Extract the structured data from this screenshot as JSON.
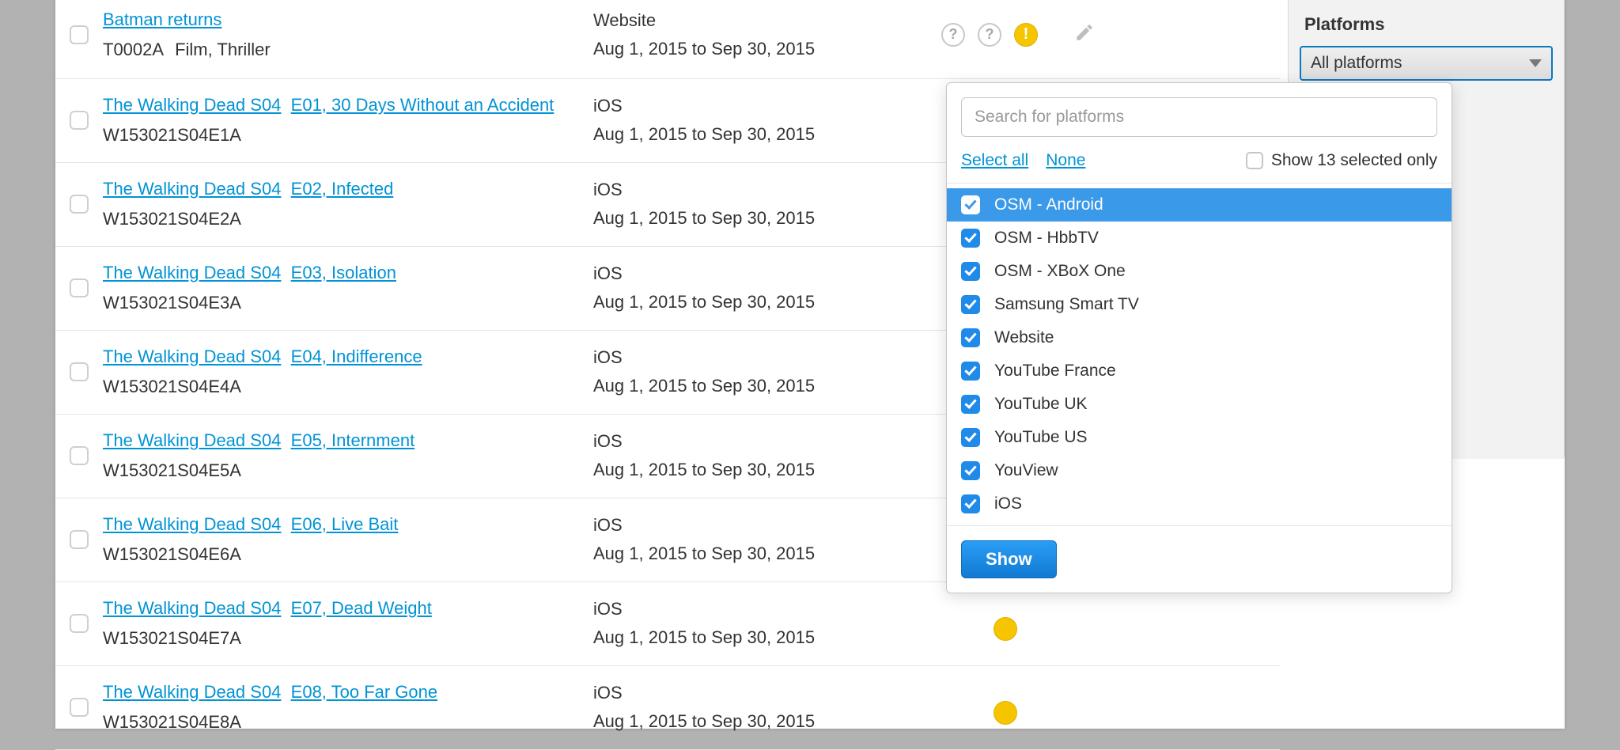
{
  "rows": [
    {
      "title_a": "Batman returns",
      "title_b": "",
      "code": "T0002A",
      "extra": "Film, Thriller",
      "platform": "Website",
      "dates": "Aug 1, 2015 to Sep 30, 2015",
      "show_icons": true
    },
    {
      "title_a": "The Walking Dead S04",
      "title_b": "E01, 30 Days Without an Accident",
      "code": "W153021S04E1A",
      "extra": "",
      "platform": "iOS",
      "dates": "Aug 1, 2015 to Sep 30, 2015",
      "show_icons": false
    },
    {
      "title_a": "The Walking Dead S04",
      "title_b": "E02, Infected",
      "code": "W153021S04E2A",
      "extra": "",
      "platform": "iOS",
      "dates": "Aug 1, 2015 to Sep 30, 2015",
      "show_icons": false
    },
    {
      "title_a": "The Walking Dead S04",
      "title_b": "E03, Isolation",
      "code": "W153021S04E3A",
      "extra": "",
      "platform": "iOS",
      "dates": "Aug 1, 2015 to Sep 30, 2015",
      "show_icons": false
    },
    {
      "title_a": "The Walking Dead S04",
      "title_b": "E04, Indifference",
      "code": "W153021S04E4A",
      "extra": "",
      "platform": "iOS",
      "dates": "Aug 1, 2015 to Sep 30, 2015",
      "show_icons": false
    },
    {
      "title_a": "The Walking Dead S04",
      "title_b": "E05, Internment",
      "code": "W153021S04E5A",
      "extra": "",
      "platform": "iOS",
      "dates": "Aug 1, 2015 to Sep 30, 2015",
      "show_icons": false
    },
    {
      "title_a": "The Walking Dead S04",
      "title_b": "E06, Live Bait",
      "code": "W153021S04E6A",
      "extra": "",
      "platform": "iOS",
      "dates": "Aug 1, 2015 to Sep 30, 2015",
      "show_icons": false
    },
    {
      "title_a": "The Walking Dead S04",
      "title_b": "E07, Dead Weight",
      "code": "W153021S04E7A",
      "extra": "",
      "platform": "iOS",
      "dates": "Aug 1, 2015 to Sep 30, 2015",
      "show_icons": false
    },
    {
      "title_a": "The Walking Dead S04",
      "title_b": "E08, Too Far Gone",
      "code": "W153021S04E8A",
      "extra": "",
      "platform": "iOS",
      "dates": "Aug 1, 2015 to Sep 30, 2015",
      "show_icons": false
    }
  ],
  "side": {
    "header": "Platforms",
    "combo": "All platforms"
  },
  "popup": {
    "search_ph": "Search for platforms",
    "select_all": "Select all",
    "none": "None",
    "show_selected": "Show 13 selected only",
    "options": [
      "OSM - Android",
      "OSM - HbbTV",
      "OSM - XBoX One",
      "Samsung Smart TV",
      "Website",
      "YouTube France",
      "YouTube UK",
      "YouTube US",
      "YouView",
      "iOS"
    ],
    "show_btn": "Show"
  }
}
